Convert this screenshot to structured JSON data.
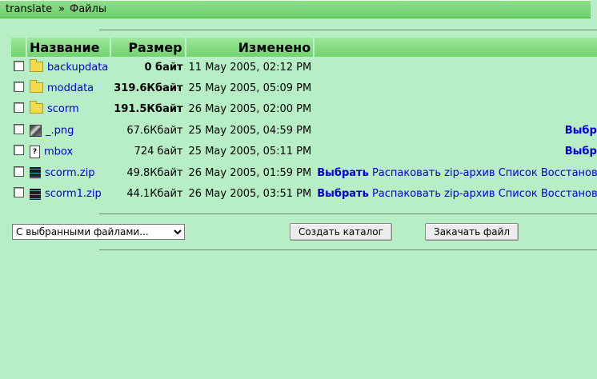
{
  "breadcrumb": {
    "course": "translate",
    "separator": "»",
    "current": "Файлы"
  },
  "table": {
    "headers": {
      "name": "Название",
      "size": "Размер",
      "modified": "Изменено"
    },
    "rows": [
      {
        "icon": "folder-icon",
        "name": "backupdata",
        "size": "0 байт",
        "size_bold": true,
        "modified": "11 May 2005, 02:12 PM",
        "actions": []
      },
      {
        "icon": "folder-icon",
        "name": "moddata",
        "size": "319.6Кбайт",
        "size_bold": true,
        "modified": "25 May 2005, 05:09 PM",
        "actions": []
      },
      {
        "icon": "folder-icon",
        "name": "scorm",
        "size": "191.5Кбайт",
        "size_bold": true,
        "modified": "26 May 2005, 02:00 PM",
        "actions": []
      },
      {
        "icon": "image-file-icon",
        "name": "_.png",
        "size": "67.6Кбайт",
        "size_bold": false,
        "modified": "25 May 2005, 04:59 PM",
        "actions": [
          "Выбрать"
        ]
      },
      {
        "icon": "text-file-icon",
        "name": "mbox",
        "size": "724 байт",
        "size_bold": false,
        "modified": "25 May 2005, 05:11 PM",
        "actions": [
          "Выбрать"
        ]
      },
      {
        "icon": "zip-file-icon",
        "name": "scorm.zip",
        "size": "49.8Кбайт",
        "size_bold": false,
        "modified": "26 May 2005, 01:59 PM",
        "actions": [
          "Выбрать",
          "Распаковать zip-архив",
          "Список",
          "Восстановить"
        ]
      },
      {
        "icon": "zip-file-icon",
        "name": "scorm1.zip",
        "size": "44.1Кбайт",
        "size_bold": false,
        "modified": "26 May 2005, 03:51 PM",
        "actions": [
          "Выбрать",
          "Распаковать zip-архив",
          "Список",
          "Восстановить"
        ]
      }
    ]
  },
  "controls": {
    "with_selected": "С выбранными файлами...",
    "create_folder": "Создать каталог",
    "upload_file": "Закачать файл"
  },
  "colors": {
    "background": "#b7eec5",
    "header_green": "#72d26f",
    "link": "#0000d6"
  }
}
